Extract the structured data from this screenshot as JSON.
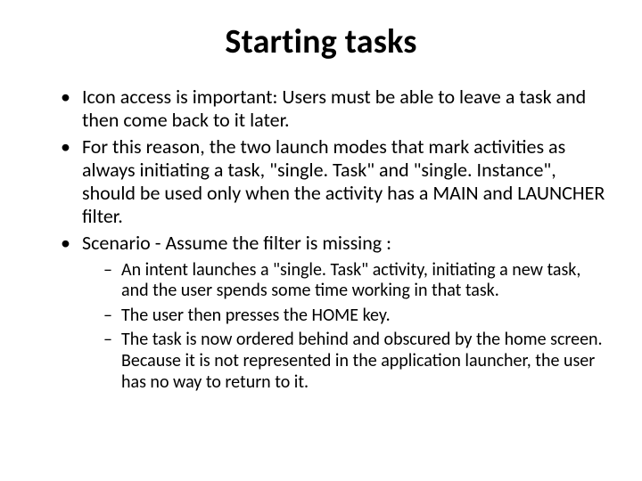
{
  "slide": {
    "title": "Starting tasks",
    "bullets": [
      "Icon access is important: Users must be able to leave a task and then come back to it later.",
      "For this reason, the two launch modes that mark activities as always initiating a task, \"single. Task\" and \"single. Instance\", should be used only when the activity has a MAIN and LAUNCHER filter.",
      "Scenario - Assume the filter is missing :"
    ],
    "subbullets": [
      "An intent launches a \"single. Task\" activity, initiating a new task, and the user spends some time working in that task.",
      "The user then presses the HOME key.",
      "The task is now ordered behind and obscured by the home screen. Because it is not represented in the application launcher, the user has no way to return to it."
    ]
  }
}
